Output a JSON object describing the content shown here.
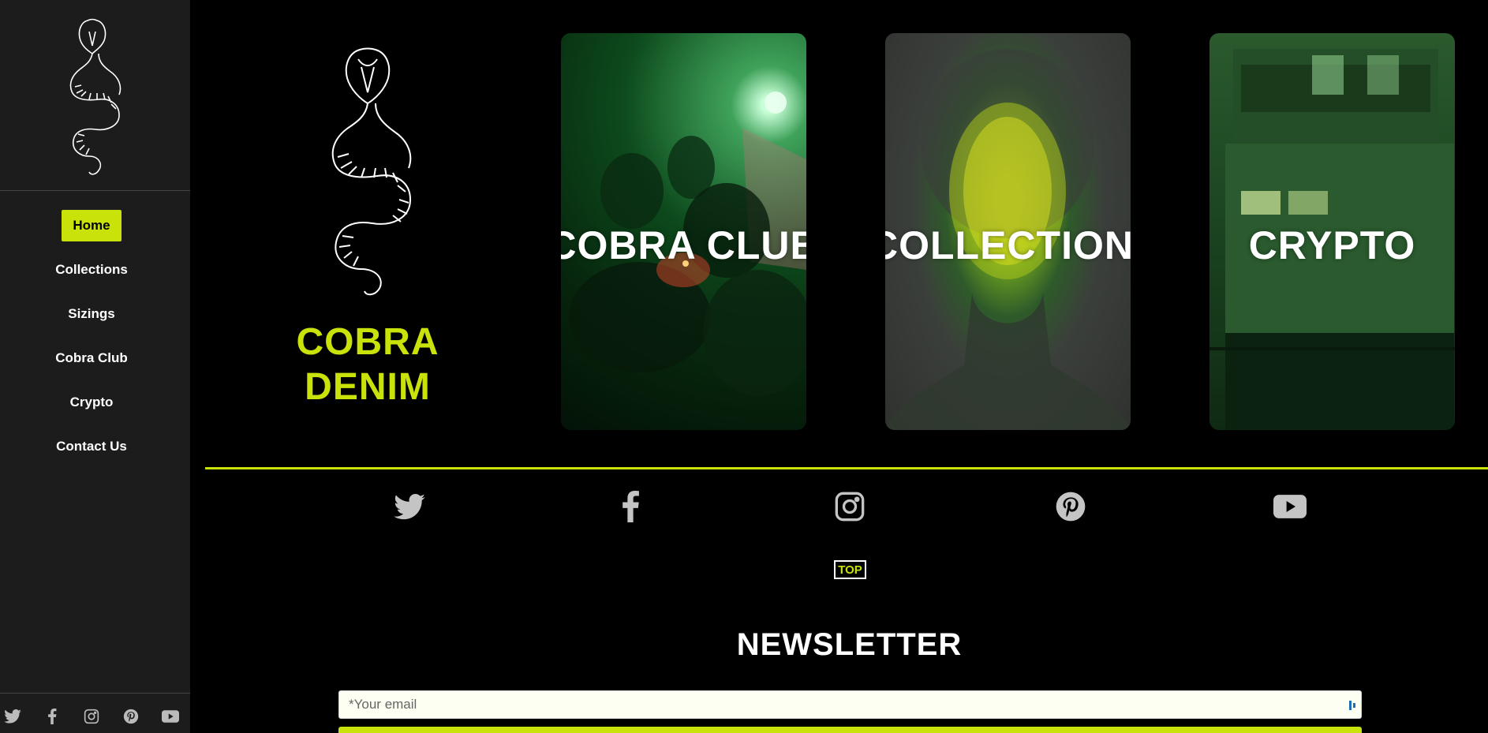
{
  "brand": {
    "name": "COBRA DENIM",
    "accent_color": "#c8e20a"
  },
  "sidebar": {
    "logo_icon": "cobra-logo-icon",
    "nav": [
      {
        "label": "Home",
        "active": true
      },
      {
        "label": "Collections",
        "active": false
      },
      {
        "label": "Sizings",
        "active": false
      },
      {
        "label": "Cobra Club",
        "active": false
      },
      {
        "label": "Crypto",
        "active": false
      },
      {
        "label": "Contact Us",
        "active": false
      }
    ],
    "social": [
      "twitter-icon",
      "facebook-icon",
      "instagram-icon",
      "pinterest-icon",
      "youtube-icon"
    ]
  },
  "hero": {
    "logo_icon": "cobra-logo-icon",
    "title_line1": "COBRA",
    "title_line2": "DENIM",
    "cards": [
      {
        "label": "COBRA CLUB"
      },
      {
        "label": "COLLECTIONS"
      },
      {
        "label": "CRYPTO"
      }
    ]
  },
  "footer": {
    "social": [
      "twitter-icon",
      "facebook-icon",
      "instagram-icon",
      "pinterest-icon",
      "youtube-icon"
    ],
    "top_label": "TOP",
    "newsletter_title": "NEWSLETTER",
    "email_placeholder": "*Your email"
  }
}
